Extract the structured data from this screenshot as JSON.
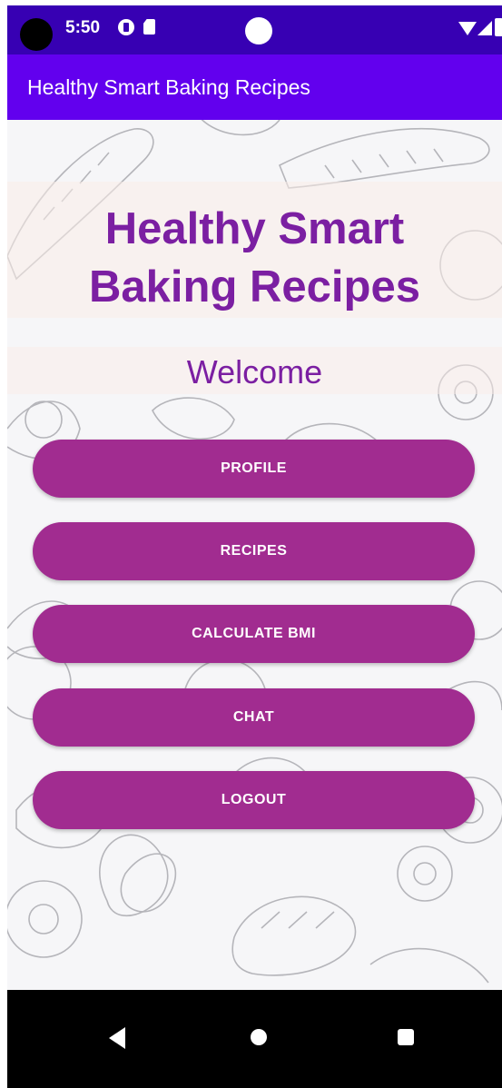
{
  "status_bar": {
    "time": "5:50"
  },
  "app_bar": {
    "title": "Healthy Smart Baking Recipes"
  },
  "main": {
    "heading_line1": "Healthy Smart",
    "heading_line2": "Baking Recipes",
    "welcome": "Welcome"
  },
  "buttons": [
    {
      "label": "PROFILE"
    },
    {
      "label": "RECIPES"
    },
    {
      "label": "CALCULATE BMI"
    },
    {
      "label": "CHAT"
    },
    {
      "label": "LOGOUT"
    }
  ],
  "colors": {
    "status_bar": "#3700b3",
    "app_bar": "#6200ee",
    "title_text": "#7b1fa2",
    "button": "#a12c90"
  },
  "icons": {
    "nav_back": "back-triangle-icon",
    "nav_home": "home-circle-icon",
    "nav_recents": "recents-square-icon"
  }
}
